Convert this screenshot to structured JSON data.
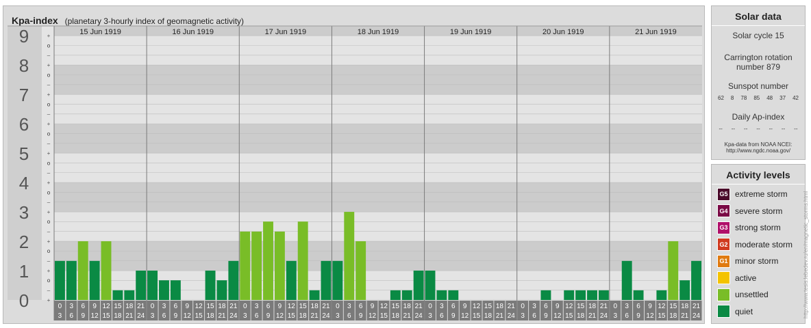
{
  "header": {
    "title": "Kpa-index",
    "subtitle": "(planetary 3-hourly index of geomagnetic activity)"
  },
  "chart_data": {
    "type": "bar",
    "title": "Kpa-index",
    "subtitle": "(planetary 3-hourly index of geomagnetic activity)",
    "ylim": [
      0,
      9
    ],
    "y_ticks": [
      "0",
      "1",
      "2",
      "3",
      "4",
      "5",
      "6",
      "7",
      "8",
      "9"
    ],
    "y_subticks": [
      "o",
      "+",
      "–",
      "o"
    ],
    "days": [
      "15 Jun 1919",
      "16 Jun 1919",
      "17 Jun 1919",
      "18 Jun 1919",
      "19 Jun 1919",
      "20 Jun 1919",
      "21 Jun 1919"
    ],
    "interval_labels": [
      [
        "0",
        "3"
      ],
      [
        "3",
        "6"
      ],
      [
        "6",
        "9"
      ],
      [
        "9",
        "12"
      ],
      [
        "12",
        "15"
      ],
      [
        "15",
        "18"
      ],
      [
        "18",
        "21"
      ],
      [
        "21",
        "24"
      ]
    ],
    "values": [
      [
        1.33,
        1.33,
        2.0,
        1.33,
        2.0,
        0.33,
        0.33,
        1.0
      ],
      [
        1.0,
        0.67,
        0.67,
        0.0,
        0.0,
        1.0,
        0.67,
        1.33
      ],
      [
        2.33,
        2.33,
        2.67,
        2.33,
        1.33,
        2.67,
        0.33,
        1.33
      ],
      [
        1.33,
        3.0,
        2.0,
        0.0,
        0.0,
        0.33,
        0.33,
        1.0
      ],
      [
        1.0,
        0.33,
        0.33,
        0.0,
        0.0,
        0.0,
        0.0,
        0.0
      ],
      [
        0.0,
        0.0,
        0.33,
        0.0,
        0.33,
        0.33,
        0.33,
        0.33
      ],
      [
        0.0,
        1.33,
        0.33,
        0.0,
        0.33,
        2.0,
        0.67,
        1.33
      ]
    ],
    "band_colors": [
      "#e4e4e4",
      "#cccccc"
    ],
    "colors": {
      "quiet": "#0a8a44",
      "unsettled": "#79bd27"
    }
  },
  "solar": {
    "title": "Solar data",
    "cycle": "Solar cycle 15",
    "carrington_line1": "Carrington rotation",
    "carrington_line2": "number 879",
    "sunspot_title": "Sunspot number",
    "sunspots": [
      "62",
      "8",
      "78",
      "85",
      "48",
      "37",
      "42"
    ],
    "ap_title": "Daily Ap-index",
    "ap_values": [
      "--",
      "--",
      "--",
      "--",
      "--",
      "--",
      "--"
    ],
    "source_line1": "Kpa-data from NOAA NCEI:",
    "source_line2": "http://www.ngdc.noaa.gov/"
  },
  "legend": {
    "title": "Activity levels",
    "items": [
      {
        "code": "G5",
        "label": "extreme storm",
        "color": "#4a0a2a"
      },
      {
        "code": "G4",
        "label": "severe storm",
        "color": "#7a0a45"
      },
      {
        "code": "G3",
        "label": "strong storm",
        "color": "#b0106a"
      },
      {
        "code": "G2",
        "label": "moderate storm",
        "color": "#d03a20"
      },
      {
        "code": "G1",
        "label": "minor storm",
        "color": "#e07a10"
      },
      {
        "code": "",
        "label": "active",
        "color": "#f4c300"
      },
      {
        "code": "",
        "label": "unsettled",
        "color": "#79bd27"
      },
      {
        "code": "",
        "label": "quiet",
        "color": "#0a8a44"
      }
    ]
  },
  "watermark": "http://www.tesis.lebedev.ru/en/magnetic_storms.html"
}
